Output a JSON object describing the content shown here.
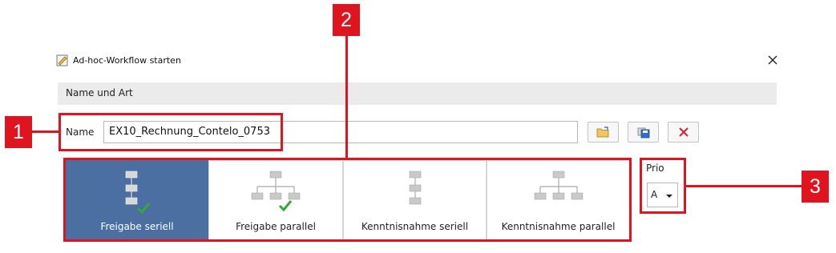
{
  "dialog": {
    "title": "Ad-hoc-Workflow starten",
    "title_icon": "workflow-start-icon",
    "close_icon": "close-icon"
  },
  "section": {
    "label": "Name und Art"
  },
  "name_field": {
    "label": "Name",
    "value": "EX10_Rechnung_Contelo_0753"
  },
  "toolbar": [
    {
      "name": "open-folder-button",
      "icon": "open-folder-icon"
    },
    {
      "name": "save-button",
      "icon": "save-icon"
    },
    {
      "name": "delete-button",
      "icon": "red-x-icon"
    }
  ],
  "workflow_types": [
    {
      "label": "Freigabe seriell",
      "icon": "serial-approval-icon",
      "selected": true
    },
    {
      "label": "Freigabe parallel",
      "icon": "parallel-approval-icon",
      "selected": false
    },
    {
      "label": "Kenntnisnahme seriell",
      "icon": "serial-acknowledge-icon",
      "selected": false
    },
    {
      "label": "Kenntnisnahme parallel",
      "icon": "parallel-acknowledge-icon",
      "selected": false
    }
  ],
  "priority": {
    "label": "Prio",
    "value": "A"
  },
  "callouts": [
    "1",
    "2",
    "3"
  ],
  "colors": {
    "selected_tile": "#4a6fa0",
    "callout": "#e0141e",
    "check": "#3aa63a",
    "node": "#b5b5b5"
  }
}
